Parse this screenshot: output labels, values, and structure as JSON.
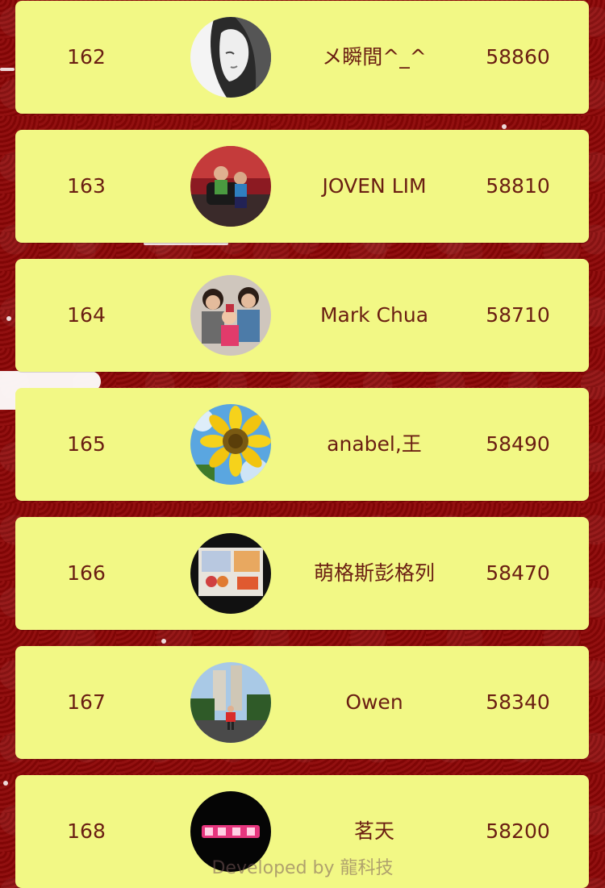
{
  "leaderboard": {
    "rows": [
      {
        "rank": "162",
        "name": "メ瞬間^_^",
        "score": "58860",
        "avatar_icon": "girl-sketch-avatar-icon"
      },
      {
        "rank": "163",
        "name": "JOVEN LIM",
        "score": "58810",
        "avatar_icon": "kids-on-car-avatar-icon"
      },
      {
        "rank": "164",
        "name": "Mark Chua",
        "score": "58710",
        "avatar_icon": "family-photo-avatar-icon"
      },
      {
        "rank": "165",
        "name": "anabel,王",
        "score": "58490",
        "avatar_icon": "sunflower-avatar-icon"
      },
      {
        "rank": "166",
        "name": "萌格斯彭格列",
        "score": "58470",
        "avatar_icon": "presentation-slide-avatar-icon"
      },
      {
        "rank": "167",
        "name": "Owen",
        "score": "58340",
        "avatar_icon": "street-photo-avatar-icon"
      },
      {
        "rank": "168",
        "name": "茗天",
        "score": "58200",
        "avatar_icon": "pink-text-avatar-icon"
      }
    ]
  },
  "footer": {
    "text": "Developed by 龍科技"
  },
  "colors": {
    "row_background": "#f2f885",
    "text": "#6a1e12",
    "page_background": "#8a0e0e"
  }
}
